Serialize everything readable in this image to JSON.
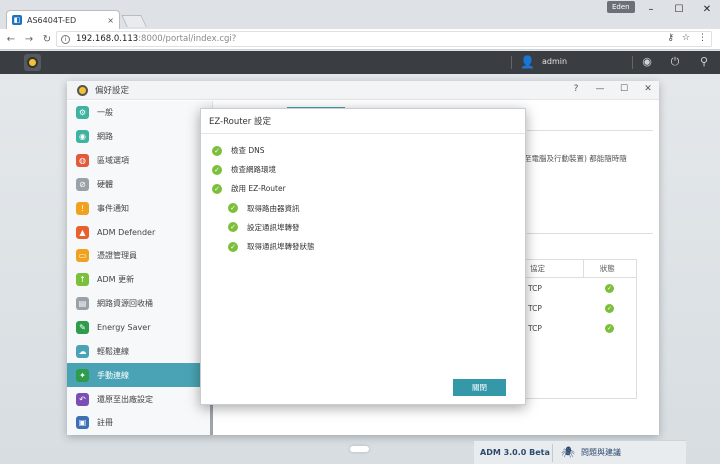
{
  "browser": {
    "tab_title": "AS6404T-ED",
    "tab_close": "×",
    "profile": "Eden",
    "url_host": "192.168.0.113",
    "url_rest": ":8000/portal/index.cgi?",
    "min_glyph": "–",
    "max_glyph": "☐",
    "close_glyph": "✕"
  },
  "adm_bar": {
    "user": "admin"
  },
  "pref_window": {
    "title": "偏好設定",
    "help": "?",
    "min": "—",
    "max": "☐",
    "close": "✕",
    "sidebar": [
      {
        "label": "一般",
        "color": "#3fb3a1",
        "glyph": "⚙"
      },
      {
        "label": "網路",
        "color": "#3fb3a1",
        "glyph": "◉"
      },
      {
        "label": "區域選項",
        "color": "#e25a3a",
        "glyph": "◍"
      },
      {
        "label": "硬體",
        "color": "#9aa1a8",
        "glyph": "⊘"
      },
      {
        "label": "事件通知",
        "color": "#f0a21e",
        "glyph": "!"
      },
      {
        "label": "ADM Defender",
        "color": "#e8612c",
        "glyph": "▲"
      },
      {
        "label": "憑證管理員",
        "color": "#f0a21e",
        "glyph": "▭"
      },
      {
        "label": "ADM 更新",
        "color": "#7bbf3a",
        "glyph": "↑"
      },
      {
        "label": "網路資源回收桶",
        "color": "#9aa1a8",
        "glyph": "▤"
      },
      {
        "label": "Energy Saver",
        "color": "#2e9c4a",
        "glyph": "✎"
      },
      {
        "label": "輕鬆連線",
        "color": "#4aa3b4",
        "glyph": "☁"
      },
      {
        "label": "手動連線",
        "color": "#2e9c4a",
        "glyph": "✦",
        "active": true
      },
      {
        "label": "還原至出廠設定",
        "color": "#7a4fb3",
        "glyph": "↶"
      },
      {
        "label": "註冊",
        "color": "#3b6fb6",
        "glyph": "▣"
      }
    ],
    "content": {
      "desc": "至電腦及行動裝置) 都能隨時隨",
      "table": {
        "headers": [
          "協定",
          "狀態"
        ],
        "rows": [
          "TCP",
          "TCP",
          "TCP"
        ]
      }
    }
  },
  "dialog": {
    "title": "EZ-Router 設定",
    "steps": [
      {
        "label": "檢查 DNS",
        "level": 0
      },
      {
        "label": "檢查網路環境",
        "level": 0
      },
      {
        "label": "啟用 EZ-Router",
        "level": 0
      },
      {
        "label": "取得路由器資訊",
        "level": 1
      },
      {
        "label": "設定通訊埠轉發",
        "level": 1
      },
      {
        "label": "取得通訊埠轉發狀態",
        "level": 1
      }
    ],
    "close_label": "關閉"
  },
  "taskbar": {
    "version": "ADM 3.0.0 Beta",
    "feedback": "問題與建議"
  },
  "colors": {
    "accent": "#4aa3b4",
    "ok": "#7bbf3a",
    "button": "#3598a9"
  }
}
